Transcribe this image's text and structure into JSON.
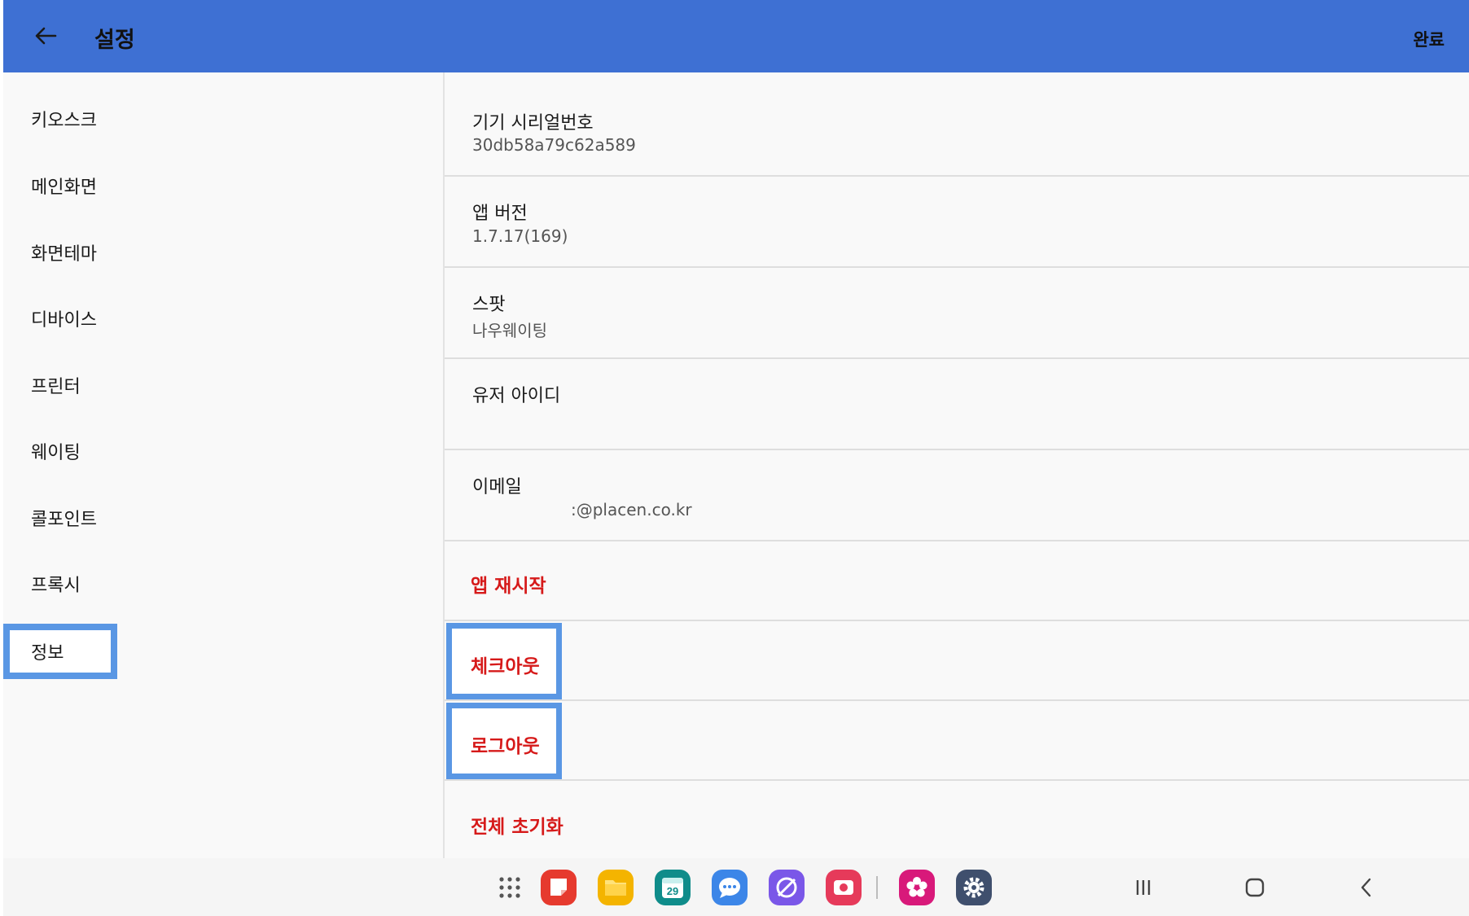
{
  "appbar": {
    "title": "설정",
    "done_label": "완료"
  },
  "sidebar": {
    "items": [
      {
        "label": "키오스크"
      },
      {
        "label": "메인화면"
      },
      {
        "label": "화면테마"
      },
      {
        "label": "디바이스"
      },
      {
        "label": "프린터"
      },
      {
        "label": "웨이팅"
      },
      {
        "label": "콜포인트"
      },
      {
        "label": "프록시"
      },
      {
        "label": "정보"
      }
    ],
    "selected": "정보"
  },
  "info": {
    "serial": {
      "title": "기기 시리얼번호",
      "value": "30db58a79c62a589"
    },
    "version": {
      "title": "앱 버전",
      "value": "1.7.17(169)"
    },
    "spot": {
      "title": "스팟",
      "value": "나우웨이팅"
    },
    "user_id": {
      "title": "유저 아이디",
      "value": ""
    },
    "email": {
      "title": "이메일",
      "value": ":@placen.co.kr"
    }
  },
  "actions": {
    "restart": "앱 재시작",
    "checkout": "체크아웃",
    "logout": "로그아웃",
    "reset": "전체 초기화"
  },
  "taskbar": {
    "calendar_day": "29",
    "apps": [
      "apps-grid-icon",
      "notes-app-icon",
      "files-app-icon",
      "calendar-app-icon",
      "messages-app-icon",
      "browser-app-icon",
      "screen-recorder-app-icon",
      "flower-app-icon",
      "settings-app-icon"
    ],
    "nav": [
      "recent-apps-icon",
      "home-icon",
      "back-icon"
    ]
  },
  "colors": {
    "appbar": "#3e70d3",
    "danger_text": "#d61a1a",
    "highlight_box": "#5a97e4"
  }
}
